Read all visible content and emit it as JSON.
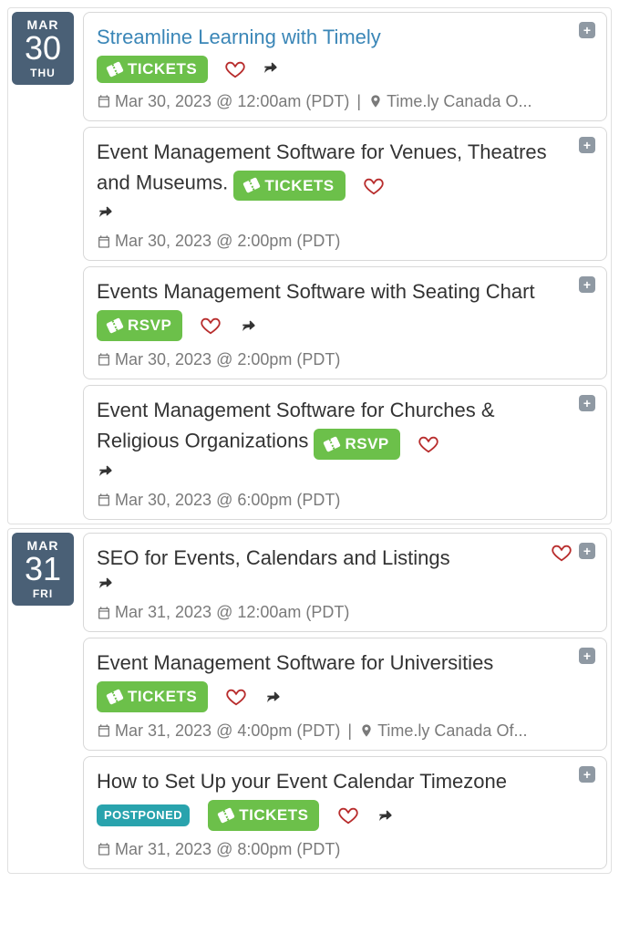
{
  "days": [
    {
      "month": "MAR",
      "day": "30",
      "wday": "THU",
      "events": [
        {
          "title": "Streamline Learning with Timely",
          "title_link": true,
          "btn": {
            "label": "TICKETS",
            "style": "green"
          },
          "heart": true,
          "share": true,
          "inline_actions": false,
          "datetime": "Mar 30, 2023 @ 12:00am (PDT)",
          "location": "Time.ly Canada O..."
        },
        {
          "title": "Event Management Software for Venues, Theatres and Museums.",
          "btn": {
            "label": "TICKETS",
            "style": "green"
          },
          "heart": true,
          "share": true,
          "inline_actions": true,
          "share_wraps": true,
          "datetime": "Mar 30, 2023 @ 2:00pm (PDT)"
        },
        {
          "title": "Events Management Software with Seating Chart",
          "btn": {
            "label": "RSVP",
            "style": "green"
          },
          "heart": true,
          "share": true,
          "inline_actions": true,
          "datetime": "Mar 30, 2023 @ 2:00pm (PDT)"
        },
        {
          "title": "Event Management Software for Churches & Religious Organizations",
          "btn": {
            "label": "RSVP",
            "style": "green"
          },
          "heart": true,
          "share": true,
          "inline_actions": true,
          "share_wraps": true,
          "datetime": "Mar 30, 2023 @ 6:00pm (PDT)"
        }
      ]
    },
    {
      "month": "MAR",
      "day": "31",
      "wday": "FRI",
      "events": [
        {
          "title": "SEO for Events, Calendars and Listings",
          "heart": true,
          "share": true,
          "inline_actions": true,
          "share_wraps": true,
          "heart_near_expand": true,
          "datetime": "Mar 31, 2023 @ 12:00am (PDT)"
        },
        {
          "title": "Event Management Software for Universities",
          "btn": {
            "label": "TICKETS",
            "style": "green"
          },
          "heart": true,
          "share": true,
          "inline_actions": true,
          "datetime": "Mar 31, 2023 @ 4:00pm (PDT)",
          "location": "Time.ly Canada Of..."
        },
        {
          "title": "How to Set Up your Event Calendar Timezone",
          "badge": {
            "label": "POSTPONED",
            "style": "teal"
          },
          "btn": {
            "label": "TICKETS",
            "style": "green"
          },
          "heart": true,
          "share": true,
          "inline_actions": true,
          "datetime": "Mar 31, 2023 @ 8:00pm (PDT)"
        }
      ]
    }
  ]
}
